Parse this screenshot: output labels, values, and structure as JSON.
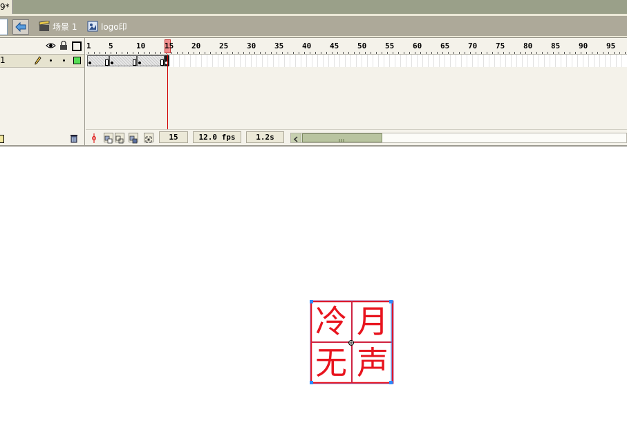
{
  "doc_tab": {
    "title_fragment": "9*"
  },
  "edit_bar": {
    "breadcrumbs": [
      {
        "label": "场景 1",
        "icon": "scene-clapper-icon"
      },
      {
        "label": "logo印",
        "icon": "graphic-symbol-icon"
      }
    ]
  },
  "timeline": {
    "header_icons": [
      "eye-icon",
      "lock-icon",
      "outline-square-icon"
    ],
    "layer": {
      "name": "1",
      "color": "#55dd55"
    },
    "ruler_labels": [
      "1",
      "5",
      "10",
      "15",
      "20",
      "25",
      "30",
      "35",
      "40",
      "45",
      "50",
      "55",
      "60",
      "65",
      "70",
      "75",
      "80",
      "85",
      "90",
      "95"
    ],
    "playhead_frame": "15",
    "status": {
      "current_frame": "15",
      "frame_rate": "12.0 fps",
      "elapsed": "1.2s"
    }
  },
  "stage": {
    "seal_characters": [
      "冷",
      "月",
      "无",
      "声"
    ],
    "seal_color": "#e8141e",
    "selection_color": "#2a8cff"
  }
}
